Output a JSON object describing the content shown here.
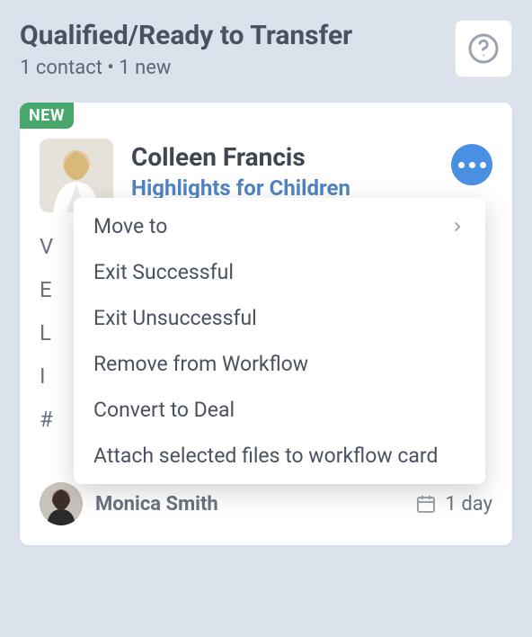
{
  "column": {
    "title": "Qualified/Ready to Transfer",
    "subtitle": "1 contact • 1 new"
  },
  "card": {
    "badge": "NEW",
    "contact": {
      "name": "Colleen Francis",
      "company": "Highlights for Children"
    },
    "fields": [
      "V",
      "E",
      "L",
      "I",
      "#"
    ],
    "footer": {
      "owner": "Monica Smith",
      "due": "1 day"
    }
  },
  "menu": {
    "items": [
      {
        "label": "Move to",
        "submenu": true
      },
      {
        "label": "Exit Successful",
        "submenu": false
      },
      {
        "label": "Exit Unsuccessful",
        "submenu": false
      },
      {
        "label": "Remove from Workflow",
        "submenu": false
      },
      {
        "label": "Convert to Deal",
        "submenu": false
      },
      {
        "label": "Attach selected files to workflow card",
        "submenu": false
      }
    ]
  }
}
